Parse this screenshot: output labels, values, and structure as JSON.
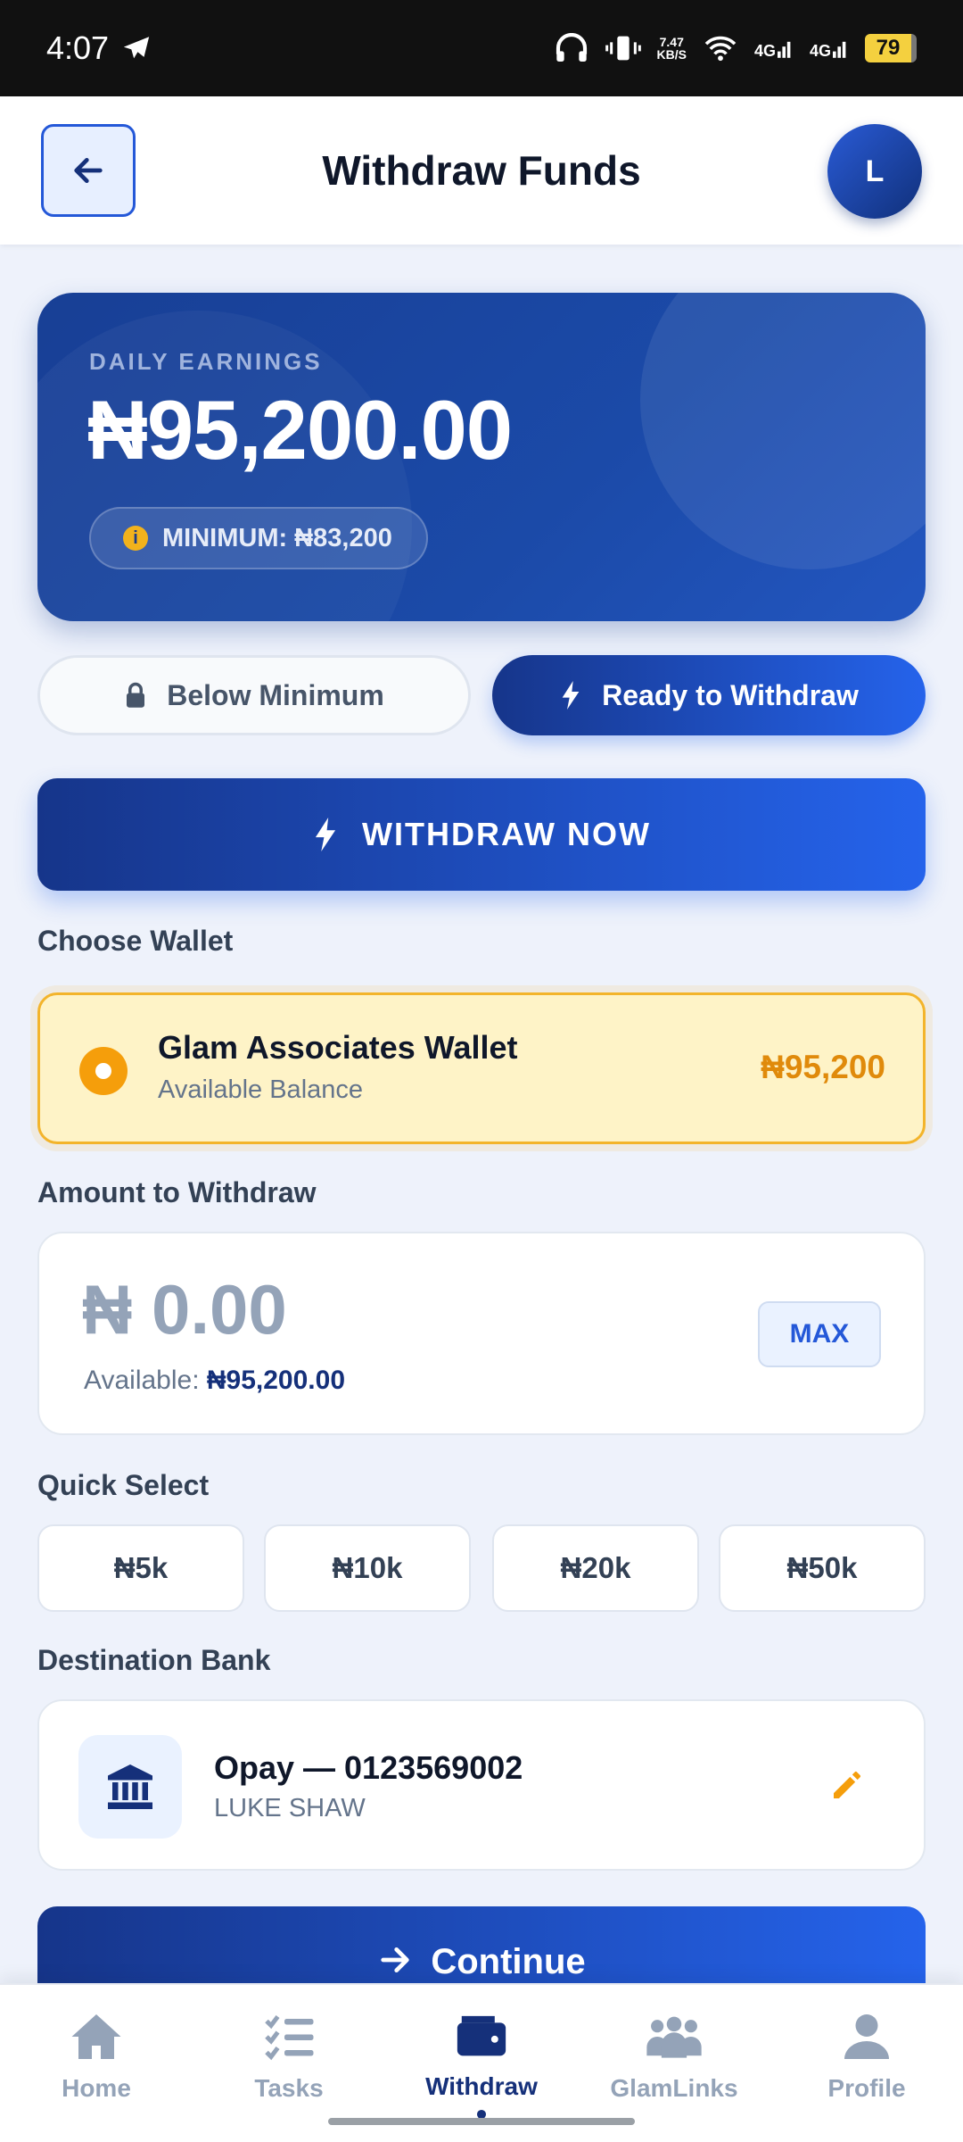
{
  "status_bar": {
    "time": "4:07",
    "net_speed_value": "7.47",
    "net_speed_unit": "KB/S",
    "sig1": "4G",
    "sig2": "4G",
    "battery": "79"
  },
  "header": {
    "title": "Withdraw Funds",
    "avatar_initial": "L"
  },
  "earnings": {
    "label": "DAILY EARNINGS",
    "amount": "₦95,200.00",
    "minimum": "MINIMUM: ₦83,200"
  },
  "status_toggles": {
    "below": "Below Minimum",
    "ready": "Ready to Withdraw"
  },
  "withdraw_now_label": "WITHDRAW NOW",
  "wallet": {
    "section_label": "Choose Wallet",
    "name": "Glam Associates Wallet",
    "subtitle": "Available Balance",
    "balance": "₦95,200"
  },
  "amount": {
    "section_label": "Amount to Withdraw",
    "value": "₦ 0.00",
    "available_prefix": "Available: ",
    "available_value": "₦95,200.00",
    "max_label": "MAX"
  },
  "quick_select": {
    "section_label": "Quick Select",
    "options": [
      "₦5k",
      "₦10k",
      "₦20k",
      "₦50k"
    ]
  },
  "bank": {
    "section_label": "Destination Bank",
    "name": "Opay — 0123569002",
    "holder": "LUKE SHAW"
  },
  "continue_label": "Continue",
  "nav": {
    "items": [
      {
        "label": "Home",
        "icon": "home-icon"
      },
      {
        "label": "Tasks",
        "icon": "tasks-icon"
      },
      {
        "label": "Withdraw",
        "icon": "wallet-icon"
      },
      {
        "label": "GlamLinks",
        "icon": "people-icon"
      },
      {
        "label": "Profile",
        "icon": "profile-icon"
      }
    ],
    "active": "Withdraw"
  },
  "colors": {
    "primary": "#16358a",
    "accent": "#2563eb",
    "warning": "#f59e0b",
    "background": "#eef2fb"
  }
}
